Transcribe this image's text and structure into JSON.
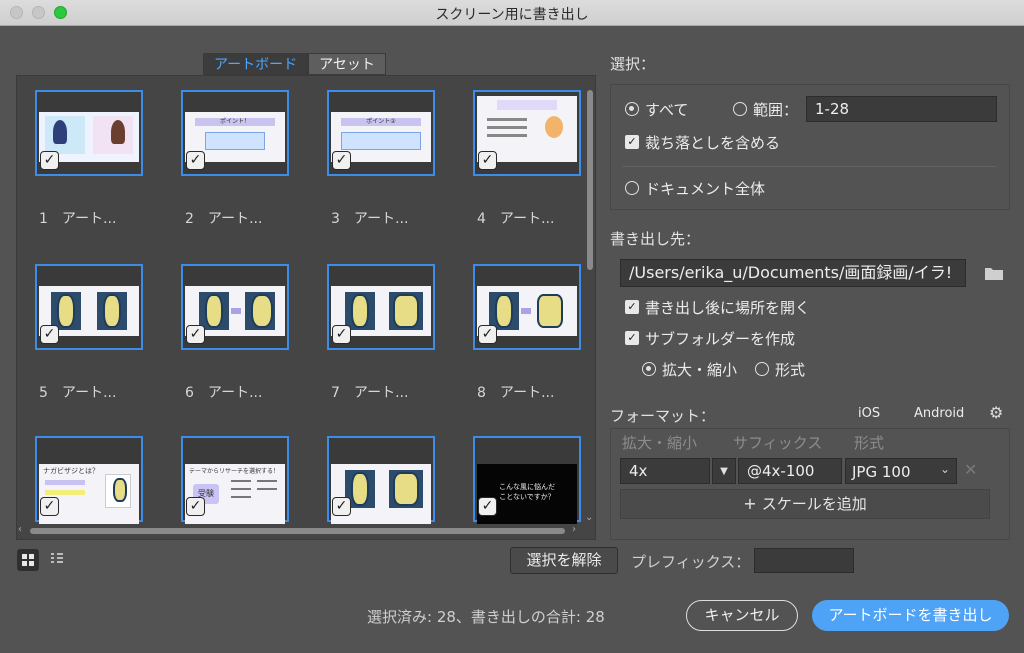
{
  "window": {
    "title": "スクリーン用に書き出し"
  },
  "tabs": {
    "artboards": "アートボード",
    "assets": "アセット"
  },
  "thumbnails": [
    {
      "label": "1　アート..."
    },
    {
      "label": "2　アート..."
    },
    {
      "label": "3　アート..."
    },
    {
      "label": "4　アート..."
    },
    {
      "label": "5　アート..."
    },
    {
      "label": "6　アート..."
    },
    {
      "label": "7　アート..."
    },
    {
      "label": "8　アート..."
    }
  ],
  "thumb_texts": {
    "t2_band": "ポイント！",
    "t3_band": "ポイント②",
    "t9_title": "ナガビザジとは？",
    "t10_title": "テーマからリサーチを選択する！",
    "t10_box": "受験",
    "t12_text": "こんな風に悩んだことないですか？"
  },
  "selection": {
    "label": "選択：",
    "all": "すべて",
    "range": "範囲：",
    "range_value": "1-28",
    "include_bleed": "裁ち落としを含める",
    "whole_document": "ドキュメント全体"
  },
  "export_to": {
    "label": "書き出し先：",
    "path": "/Users/erika_u/Documents/画面録画/イラ!",
    "open_after": "書き出し後に場所を開く",
    "create_subfolders": "サブフォルダーを作成",
    "scale": "拡大・縮小",
    "format_opt": "形式"
  },
  "format": {
    "label": "フォーマット：",
    "ios": "iOS",
    "android": "Android",
    "col_scale": "拡大・縮小",
    "col_suffix": "サフィックス",
    "col_format": "形式",
    "scale_value": "4x",
    "suffix_value": "@4x-100",
    "format_value": "JPG 100",
    "add_scale": "スケールを追加"
  },
  "footer": {
    "deselect": "選択を解除",
    "prefix": "プレフィックス：",
    "status": "選択済み: 28、書き出しの合計: 28",
    "cancel": "キャンセル",
    "export": "アートボードを書き出し"
  },
  "colors": {
    "accent": "#3d8ce8",
    "primary_button": "#4fa3f7"
  }
}
